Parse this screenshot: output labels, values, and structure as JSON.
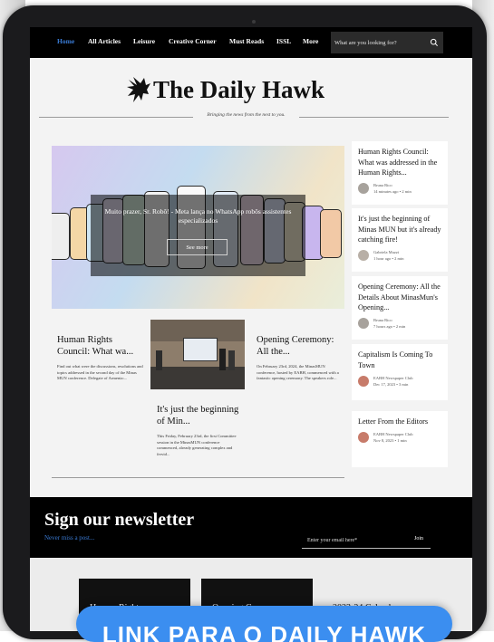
{
  "nav": {
    "items": [
      {
        "label": "Home",
        "active": true
      },
      {
        "label": "All Articles"
      },
      {
        "label": "Leisure"
      },
      {
        "label": "Creative Corner"
      },
      {
        "label": "Must Reads"
      },
      {
        "label": "ISSL"
      },
      {
        "label": "More"
      }
    ],
    "search_placeholder": "What are you looking for?",
    "search_icon": "search-icon"
  },
  "header": {
    "logo_icon": "hawk-icon",
    "title": "The Daily Hawk",
    "tagline": "Bringing the news from the nest to you."
  },
  "hero": {
    "title": "Muito prazer, Sr. Robô! - Meta lança no WhatsApp robôs assistentes especializados",
    "button_label": "See more"
  },
  "articles": [
    {
      "title": "Human Rights Council: What wa...",
      "excerpt": "Find out what were the discussions, resolutions and topics addressed in the second day of the Minas MUN conference. Delegate of Armenia:..."
    },
    {
      "title": "Opening Ceremony: All the...",
      "excerpt": "On February 23rd, 2024, the MinasMUN conference, hosted by EABH, commenced with a fantastic opening ceremony. The speakers role..."
    },
    {
      "title": "It's just the beginning of Min...",
      "excerpt": "This Friday, February 23rd, the first Committee session in the MinasMUN conference commenced, already generating complex and fervid..."
    }
  ],
  "sidebar": [
    {
      "title": "Human Rights Council: What was addressed in the Human Rights...",
      "author": "Bruna Rico",
      "meta": "14 minutes ago  •  2 min"
    },
    {
      "title": "It's just the beginning of Minas MUN but it's already catching fire!",
      "author": "Gabriela Muzzi",
      "meta": "1 hour ago  •  2 min"
    },
    {
      "title": "Opening Ceremony: All the Details About MinasMun's Opening...",
      "author": "Bruna Rico",
      "meta": "7 hours ago  •  2 min"
    },
    {
      "title": "Capitalism Is Coming To Town",
      "author": "EABH Newspaper Club",
      "meta": "Dec 17, 2023  •  3 min"
    },
    {
      "title": "Letter From the Editors",
      "author": "EABH Newspaper Club",
      "meta": "Nov 8, 2023  •  1 min"
    }
  ],
  "newsletter": {
    "title": "Sign our newsletter",
    "subtitle": "Never miss a post...",
    "email_placeholder": "Enter your email here*",
    "join_label": "Join"
  },
  "bottom": {
    "cards": [
      "Human Rights",
      "Opening Ceremony:"
    ],
    "side_title": "2023-24 Calendar"
  },
  "banner": {
    "text": "LINK PARA O DAILY HAWK",
    "color": "#3b8ef0"
  },
  "colors": {
    "accent": "#3a7bd5",
    "nav_bg": "#000000"
  }
}
